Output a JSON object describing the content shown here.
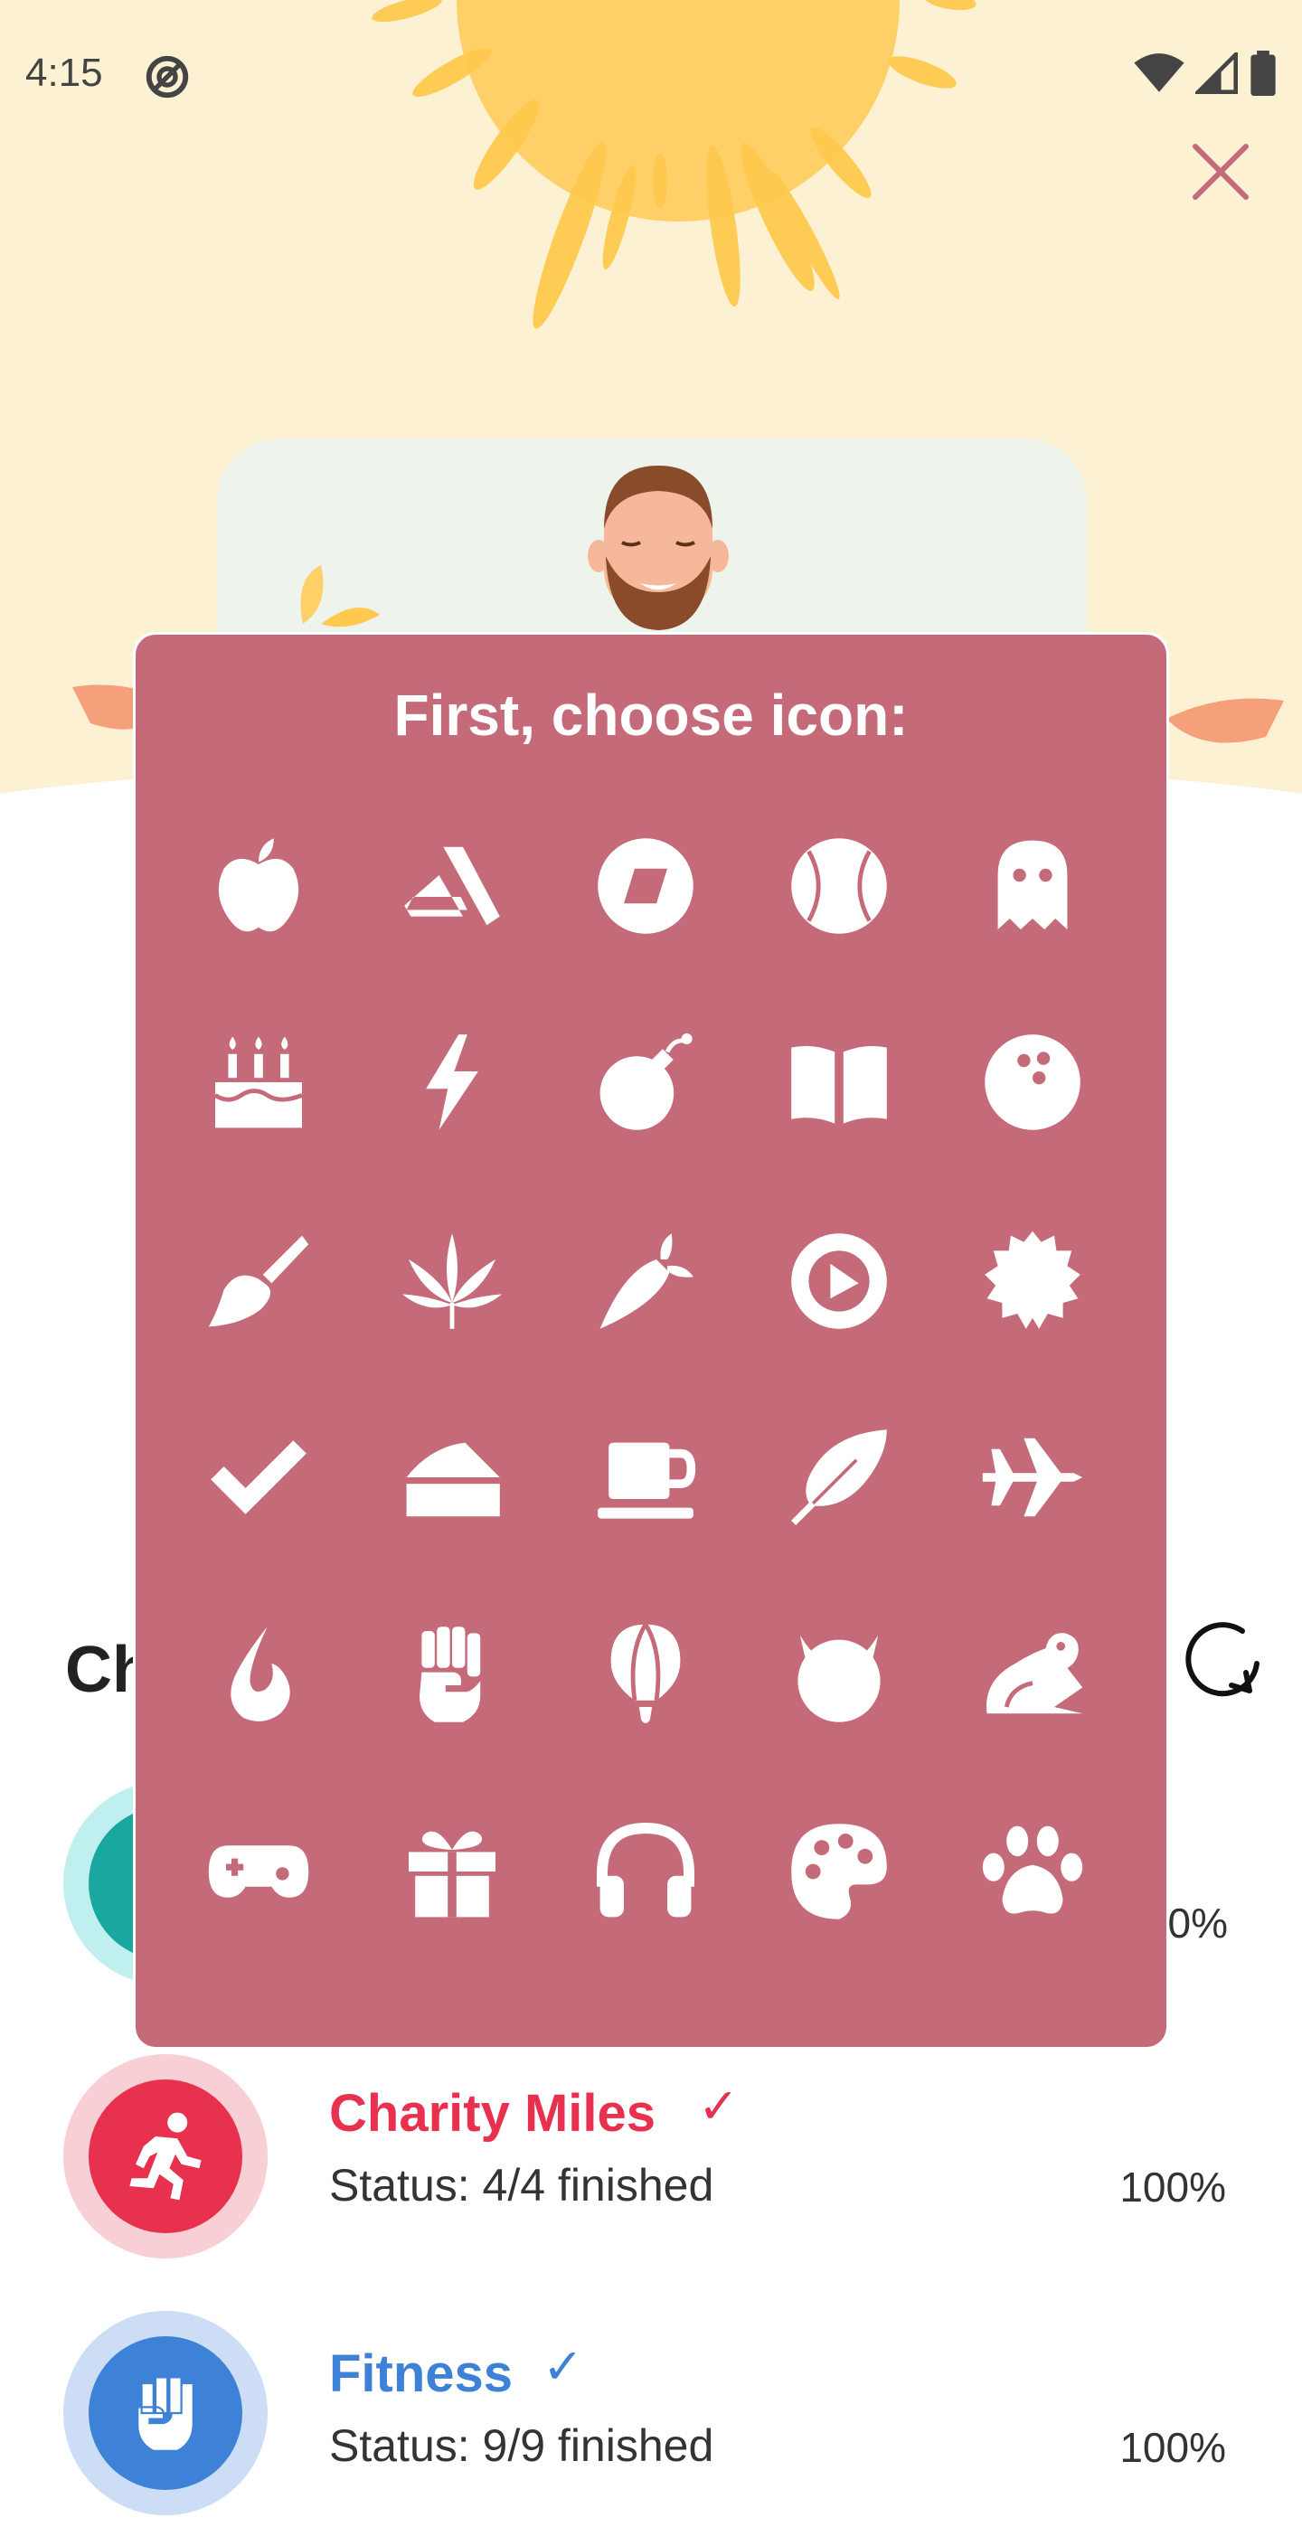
{
  "status_bar": {
    "time": "4:15"
  },
  "colors": {
    "picker_bg": "#c46a78",
    "hero_bg": "#fdf1d4",
    "close": "#c46a78",
    "charity": "#e8304f",
    "fitness": "#3d82d6"
  },
  "picker": {
    "title": "First, choose icon:",
    "icons": [
      "apple-icon",
      "artstation-icon",
      "diaspora-icon",
      "baseball-icon",
      "ghost-icon",
      "birthday-cake-icon",
      "bolt-icon",
      "bomb-icon",
      "book-open-icon",
      "bowling-ball-icon",
      "paint-brush-icon",
      "cannabis-icon",
      "carrot-icon",
      "youtube-circle-icon",
      "certificate-icon",
      "check-icon",
      "cheese-icon",
      "coffee-icon",
      "feather-icon",
      "fighter-jet-icon",
      "fire-icon",
      "fist-raised-icon",
      "hot-air-balloon-icon",
      "grinning-devil-icon",
      "frog-icon",
      "gamepad-icon",
      "gift-icon",
      "headphones-icon",
      "palette-icon",
      "paw-icon"
    ]
  },
  "section": {
    "title_visible": "Ch",
    "peek_pct": "0%"
  },
  "challenges": [
    {
      "name": "Charity Miles",
      "status": "Status: 4/4 finished",
      "percent": "100%",
      "icon": "running-icon"
    },
    {
      "name": "Fitness",
      "status": "Status: 9/9 finished",
      "percent": "100%",
      "icon": "fist-raised-icon"
    }
  ]
}
